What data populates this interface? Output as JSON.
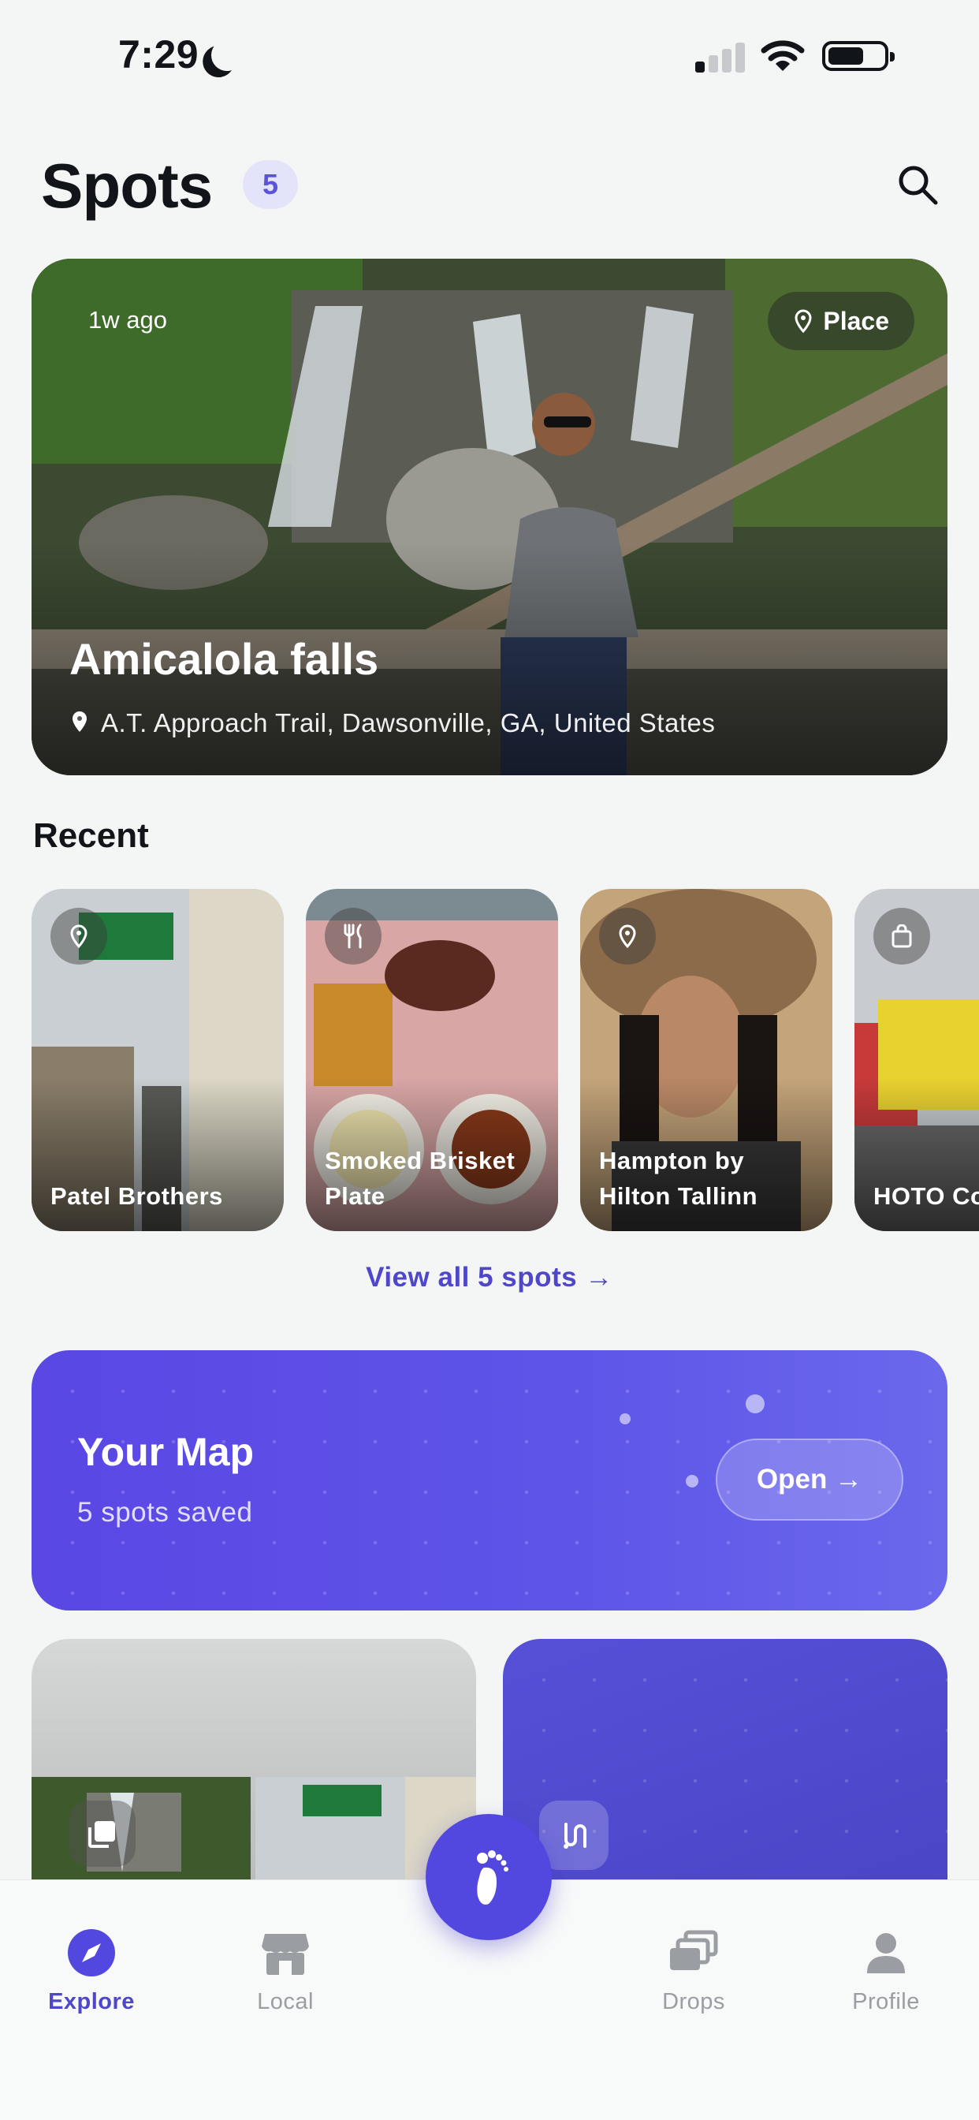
{
  "status_bar": {
    "time": "7:29"
  },
  "header": {
    "title": "Spots",
    "count": "5"
  },
  "hero": {
    "time_ago": "1w ago",
    "type_label": "Place",
    "title": "Amicalola falls",
    "address": "A.T. Approach Trail, Dawsonville, GA, United States"
  },
  "recent": {
    "title": "Recent",
    "items": [
      {
        "label": "Patel Brothers",
        "icon": "pin-icon"
      },
      {
        "label": "Smoked Brisket Plate",
        "icon": "fork-knife-icon"
      },
      {
        "label": "Hampton by Hilton Tallinn",
        "icon": "pin-icon"
      },
      {
        "label": "HOTO Cordle",
        "icon": "shopping-bag-icon"
      }
    ],
    "view_all": "View all 5 spots →"
  },
  "map_card": {
    "title": "Your Map",
    "subtitle": "5 spots saved",
    "open_label": "Open →"
  },
  "tabs": [
    {
      "label": "Explore",
      "icon": "compass-icon",
      "active": true
    },
    {
      "label": "Local",
      "icon": "storefront-icon",
      "active": false
    },
    {
      "label": "Drops",
      "icon": "stacked-cards-icon",
      "active": false
    },
    {
      "label": "Profile",
      "icon": "person-icon",
      "active": false
    }
  ],
  "fab": {
    "icon": "footprint-icon"
  },
  "colors": {
    "accent": "#5248e0",
    "accent_text": "#4f46c9",
    "badge_bg": "#e3e4fa"
  }
}
